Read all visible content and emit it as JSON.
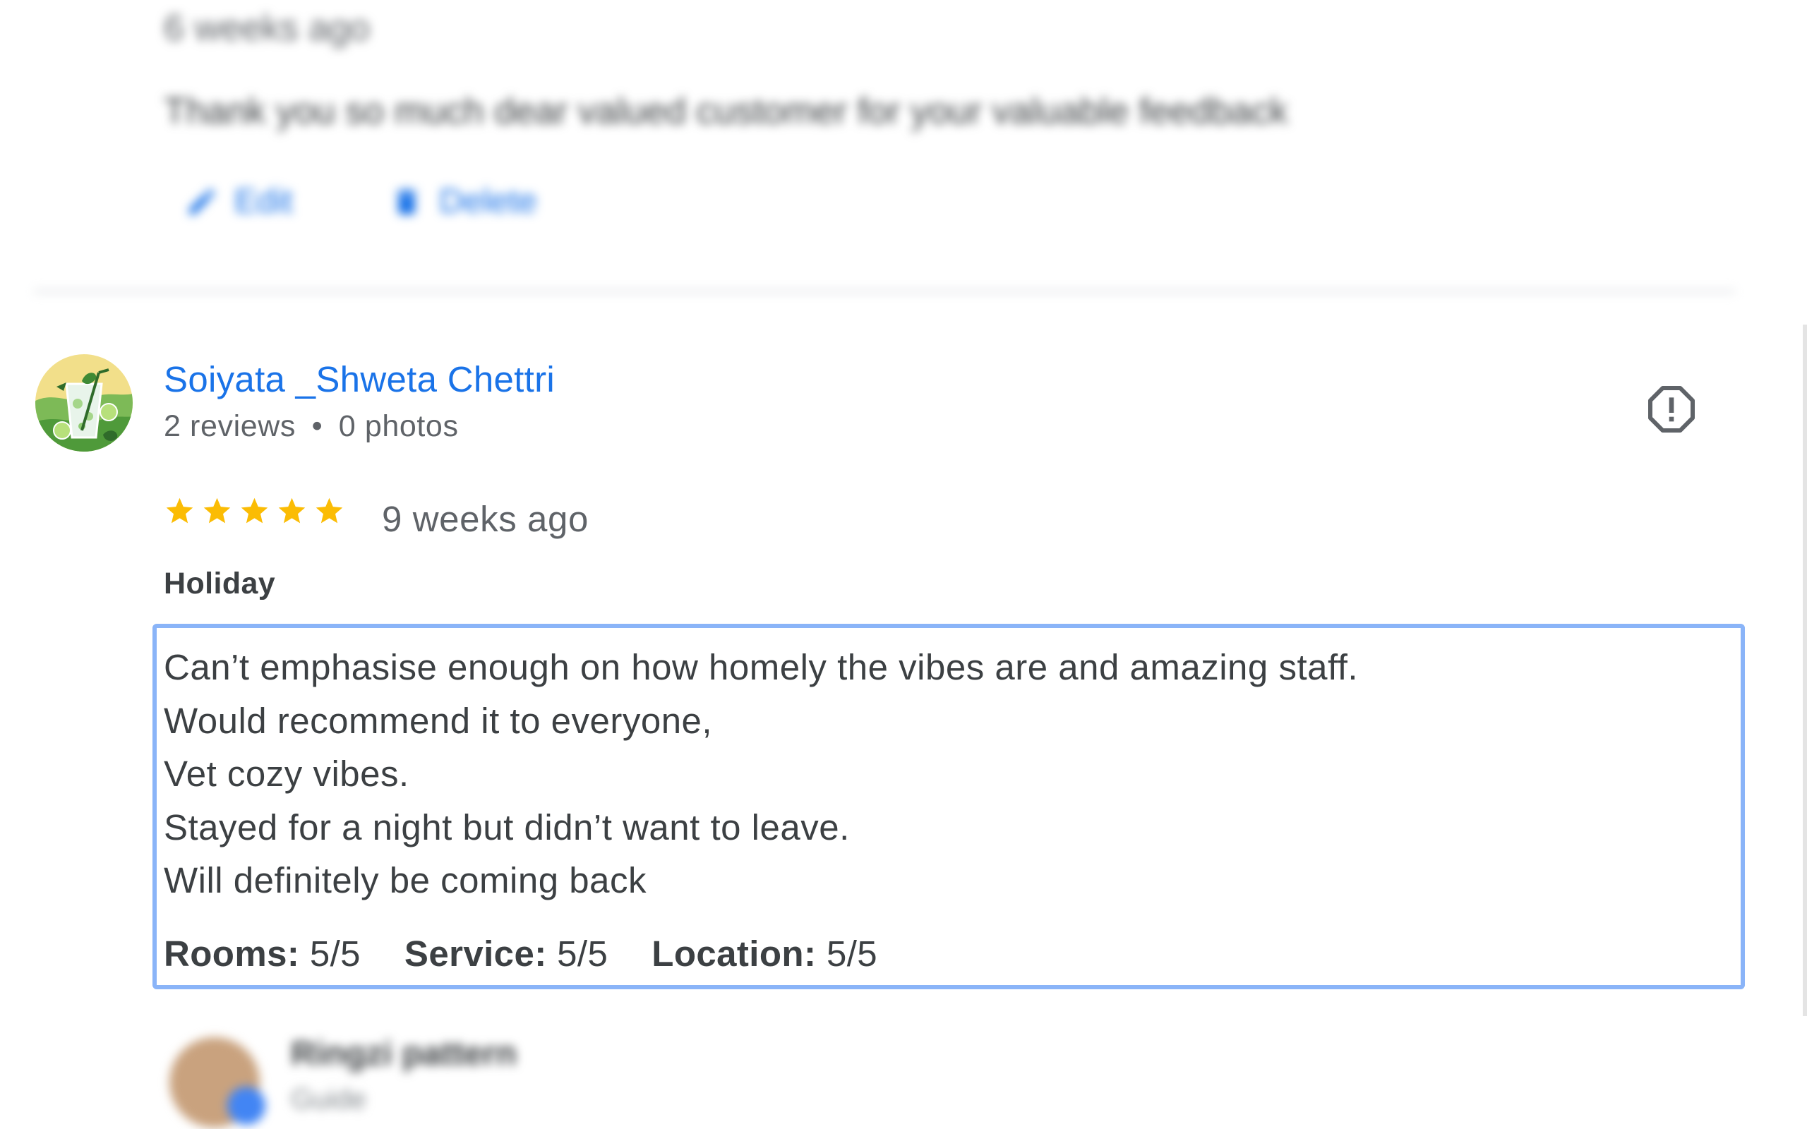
{
  "previous_review": {
    "time": "6 weeks ago",
    "owner_reply": "Thank you so much dear valued customer for your valuable feedback",
    "edit_label": "Edit",
    "delete_label": "Delete"
  },
  "review": {
    "reviewer": {
      "name": "Soiyata _Shweta Chettri",
      "reviews_count": "2 reviews",
      "separator": "•",
      "photos_count": "0 photos"
    },
    "rating": 5,
    "rating_max": 5,
    "time": "9 weeks ago",
    "trip_type": "Holiday",
    "text_lines": [
      "Can’t emphasise enough on how homely the vibes are and amazing staff.",
      "Would recommend it to everyone,",
      "Vet cozy vibes.",
      "Stayed for a night but didn’t want to leave.",
      "Will definitely be coming back"
    ],
    "sub_ratings": [
      {
        "label": "Rooms:",
        "value": "5/5"
      },
      {
        "label": "Service:",
        "value": "5/5"
      },
      {
        "label": "Location:",
        "value": "5/5"
      }
    ],
    "report_icon": "report-flag-icon"
  },
  "next_review": {
    "reviewer_name": "Ringzi pattern",
    "meta": "Guide"
  },
  "colors": {
    "link_blue": "#1a73e8",
    "star_gold": "#fbbc04",
    "highlight_border": "#8ab4f8",
    "text_primary": "#3c4043",
    "text_secondary": "#5f6368"
  }
}
